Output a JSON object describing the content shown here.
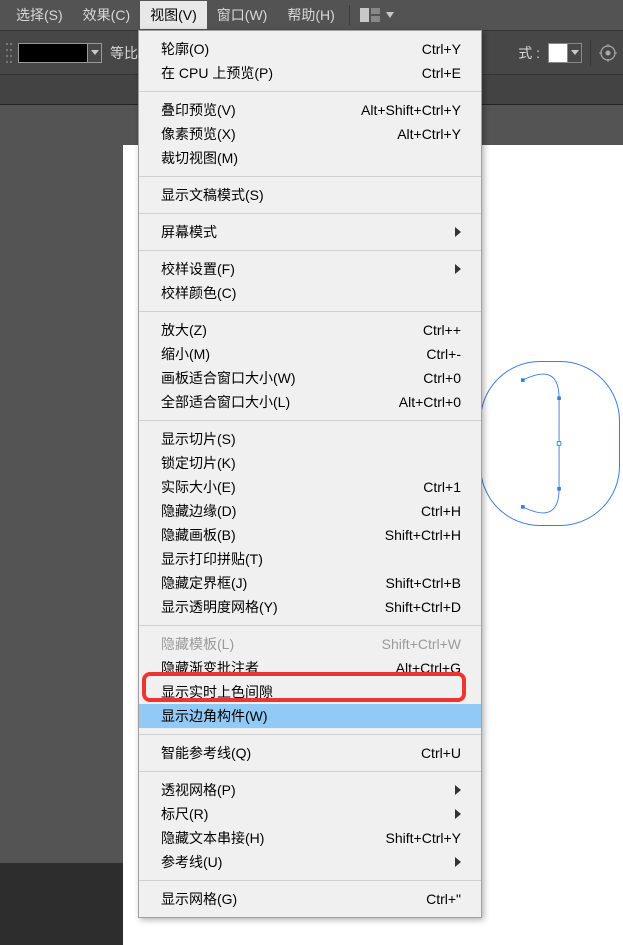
{
  "menubar": {
    "items": [
      {
        "label": "选择(S)"
      },
      {
        "label": "效果(C)"
      },
      {
        "label": "视图(V)",
        "active": true
      },
      {
        "label": "窗口(W)"
      },
      {
        "label": "帮助(H)"
      }
    ]
  },
  "toolbar": {
    "ratio_label": "等比",
    "style_label": "式 :"
  },
  "dropdown": {
    "groups": [
      [
        {
          "label": "轮廓(O)",
          "shortcut": "Ctrl+Y"
        },
        {
          "label": "在 CPU 上预览(P)",
          "shortcut": "Ctrl+E"
        }
      ],
      [
        {
          "label": "叠印预览(V)",
          "shortcut": "Alt+Shift+Ctrl+Y"
        },
        {
          "label": "像素预览(X)",
          "shortcut": "Alt+Ctrl+Y"
        },
        {
          "label": "裁切视图(M)",
          "shortcut": ""
        }
      ],
      [
        {
          "label": "显示文稿模式(S)",
          "shortcut": ""
        }
      ],
      [
        {
          "label": "屏幕模式",
          "shortcut": "",
          "submenu": true
        }
      ],
      [
        {
          "label": "校样设置(F)",
          "shortcut": "",
          "submenu": true
        },
        {
          "label": "校样颜色(C)",
          "shortcut": ""
        }
      ],
      [
        {
          "label": "放大(Z)",
          "shortcut": "Ctrl++"
        },
        {
          "label": "缩小(M)",
          "shortcut": "Ctrl+-"
        },
        {
          "label": "画板适合窗口大小(W)",
          "shortcut": "Ctrl+0"
        },
        {
          "label": "全部适合窗口大小(L)",
          "shortcut": "Alt+Ctrl+0"
        }
      ],
      [
        {
          "label": "显示切片(S)",
          "shortcut": ""
        },
        {
          "label": "锁定切片(K)",
          "shortcut": ""
        },
        {
          "label": "实际大小(E)",
          "shortcut": "Ctrl+1"
        },
        {
          "label": "隐藏边缘(D)",
          "shortcut": "Ctrl+H"
        },
        {
          "label": "隐藏画板(B)",
          "shortcut": "Shift+Ctrl+H"
        },
        {
          "label": "显示打印拼贴(T)",
          "shortcut": ""
        },
        {
          "label": "隐藏定界框(J)",
          "shortcut": "Shift+Ctrl+B"
        },
        {
          "label": "显示透明度网格(Y)",
          "shortcut": "Shift+Ctrl+D"
        }
      ],
      [
        {
          "label": "隐藏模板(L)",
          "shortcut": "Shift+Ctrl+W",
          "disabled": true
        },
        {
          "label": "隐藏渐变批注者",
          "shortcut": "Alt+Ctrl+G"
        },
        {
          "label": "显示实时上色间隙",
          "shortcut": ""
        },
        {
          "label": "显示边角构件(W)",
          "shortcut": "",
          "highlighted": true
        }
      ],
      [
        {
          "label": "智能参考线(Q)",
          "shortcut": "Ctrl+U"
        }
      ],
      [
        {
          "label": "透视网格(P)",
          "shortcut": "",
          "submenu": true
        },
        {
          "label": "标尺(R)",
          "shortcut": "",
          "submenu": true
        },
        {
          "label": "隐藏文本串接(H)",
          "shortcut": "Shift+Ctrl+Y"
        },
        {
          "label": "参考线(U)",
          "shortcut": "",
          "submenu": true
        }
      ],
      [
        {
          "label": "显示网格(G)",
          "shortcut": "Ctrl+\""
        }
      ]
    ]
  }
}
